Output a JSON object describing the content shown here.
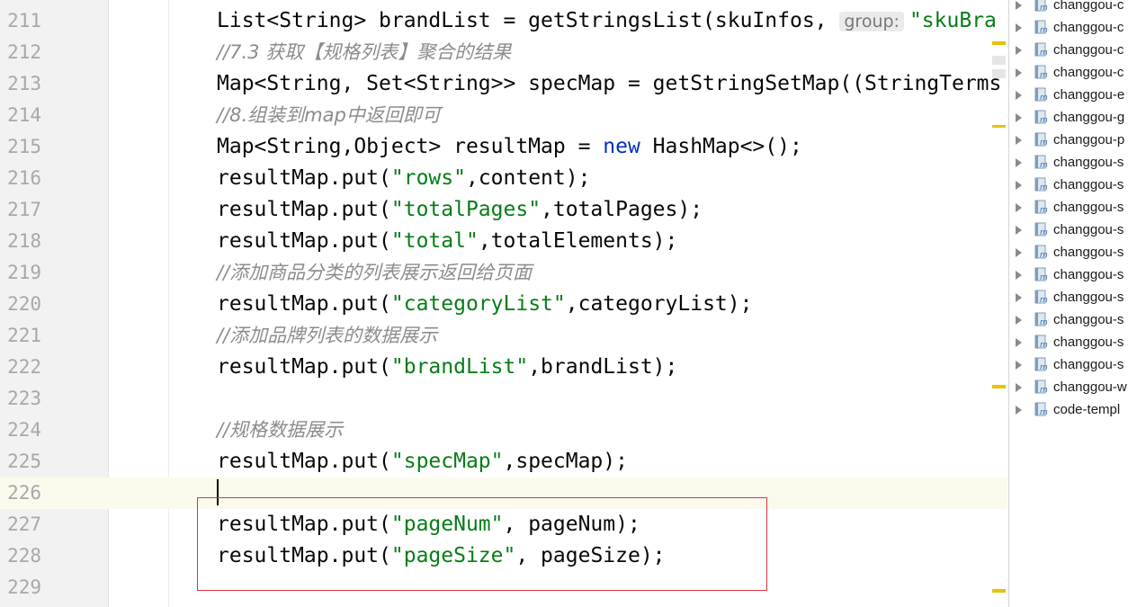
{
  "editor": {
    "current_line": "226",
    "lines": [
      {
        "num": "211",
        "tokens": [
          {
            "t": "List<String> brandList = getStringsList(skuInfos, ",
            "c": ""
          },
          {
            "t": "group:",
            "c": "hint"
          },
          {
            "t": "\"skuBra",
            "c": "str"
          }
        ]
      },
      {
        "num": "212",
        "tokens": [
          {
            "t": "//7.3 获取【规格列表】聚合的结果",
            "c": "cmt"
          }
        ]
      },
      {
        "num": "213",
        "tokens": [
          {
            "t": "Map<String, Set<String>> specMap = getStringSetMap((StringTerms",
            "c": ""
          }
        ]
      },
      {
        "num": "214",
        "tokens": [
          {
            "t": "//8.组装到map中返回即可",
            "c": "cmt"
          }
        ]
      },
      {
        "num": "215",
        "tokens": [
          {
            "t": "Map<String,Object> resultMap = ",
            "c": ""
          },
          {
            "t": "new",
            "c": "kw"
          },
          {
            "t": " HashMap<>();",
            "c": ""
          }
        ]
      },
      {
        "num": "216",
        "tokens": [
          {
            "t": "resultMap.put(",
            "c": ""
          },
          {
            "t": "\"rows\"",
            "c": "str"
          },
          {
            "t": ",content);",
            "c": ""
          }
        ]
      },
      {
        "num": "217",
        "tokens": [
          {
            "t": "resultMap.put(",
            "c": ""
          },
          {
            "t": "\"totalPages\"",
            "c": "str"
          },
          {
            "t": ",totalPages);",
            "c": ""
          }
        ]
      },
      {
        "num": "218",
        "tokens": [
          {
            "t": "resultMap.put(",
            "c": ""
          },
          {
            "t": "\"total\"",
            "c": "str"
          },
          {
            "t": ",totalElements);",
            "c": ""
          }
        ]
      },
      {
        "num": "219",
        "tokens": [
          {
            "t": "//添加商品分类的列表展示返回给页面",
            "c": "cmt"
          }
        ]
      },
      {
        "num": "220",
        "tokens": [
          {
            "t": "resultMap.put(",
            "c": ""
          },
          {
            "t": "\"categoryList\"",
            "c": "str"
          },
          {
            "t": ",categoryList);",
            "c": ""
          }
        ]
      },
      {
        "num": "221",
        "tokens": [
          {
            "t": "//添加品牌列表的数据展示",
            "c": "cmt"
          }
        ]
      },
      {
        "num": "222",
        "tokens": [
          {
            "t": "resultMap.put(",
            "c": ""
          },
          {
            "t": "\"brandList\"",
            "c": "str"
          },
          {
            "t": ",brandList);",
            "c": ""
          }
        ]
      },
      {
        "num": "223",
        "tokens": []
      },
      {
        "num": "224",
        "tokens": [
          {
            "t": "//规格数据展示",
            "c": "cmt"
          }
        ]
      },
      {
        "num": "225",
        "tokens": [
          {
            "t": "resultMap.put(",
            "c": ""
          },
          {
            "t": "\"specMap\"",
            "c": "str"
          },
          {
            "t": ",specMap);",
            "c": ""
          }
        ]
      },
      {
        "num": "226",
        "tokens": []
      },
      {
        "num": "227",
        "tokens": [
          {
            "t": "resultMap.put(",
            "c": ""
          },
          {
            "t": "\"pageNum\"",
            "c": "str"
          },
          {
            "t": ", pageNum);",
            "c": ""
          }
        ]
      },
      {
        "num": "228",
        "tokens": [
          {
            "t": "resultMap.put(",
            "c": ""
          },
          {
            "t": "\"pageSize\"",
            "c": "str"
          },
          {
            "t": ", pageSize);",
            "c": ""
          }
        ]
      },
      {
        "num": "229",
        "tokens": []
      }
    ]
  },
  "colors": {
    "string": "#067d17",
    "keyword": "#0033b3",
    "comment": "#8c8c8c",
    "highlight_box": "#d9363e",
    "current_line": "#fcfaed",
    "warning_mark": "#e8c400"
  },
  "project_tree": {
    "items": [
      {
        "label": "changgou-c",
        "icon": "maven-module-icon"
      },
      {
        "label": "changgou-c",
        "icon": "maven-module-icon"
      },
      {
        "label": "changgou-c",
        "icon": "maven-module-icon"
      },
      {
        "label": "changgou-c",
        "icon": "maven-module-icon"
      },
      {
        "label": "changgou-e",
        "icon": "maven-module-icon"
      },
      {
        "label": "changgou-g",
        "icon": "maven-module-icon"
      },
      {
        "label": "changgou-p",
        "icon": "maven-module-icon"
      },
      {
        "label": "changgou-s",
        "icon": "maven-module-icon"
      },
      {
        "label": "changgou-s",
        "icon": "maven-module-icon"
      },
      {
        "label": "changgou-s",
        "icon": "maven-module-icon"
      },
      {
        "label": "changgou-s",
        "icon": "maven-module-icon"
      },
      {
        "label": "changgou-s",
        "icon": "maven-module-icon"
      },
      {
        "label": "changgou-s",
        "icon": "maven-module-icon"
      },
      {
        "label": "changgou-s",
        "icon": "maven-module-icon"
      },
      {
        "label": "changgou-s",
        "icon": "maven-module-icon"
      },
      {
        "label": "changgou-s",
        "icon": "maven-module-icon"
      },
      {
        "label": "changgou-s",
        "icon": "maven-module-icon"
      },
      {
        "label": "changgou-w",
        "icon": "maven-module-icon"
      },
      {
        "label": "code-templ",
        "icon": "maven-module-icon"
      }
    ]
  }
}
